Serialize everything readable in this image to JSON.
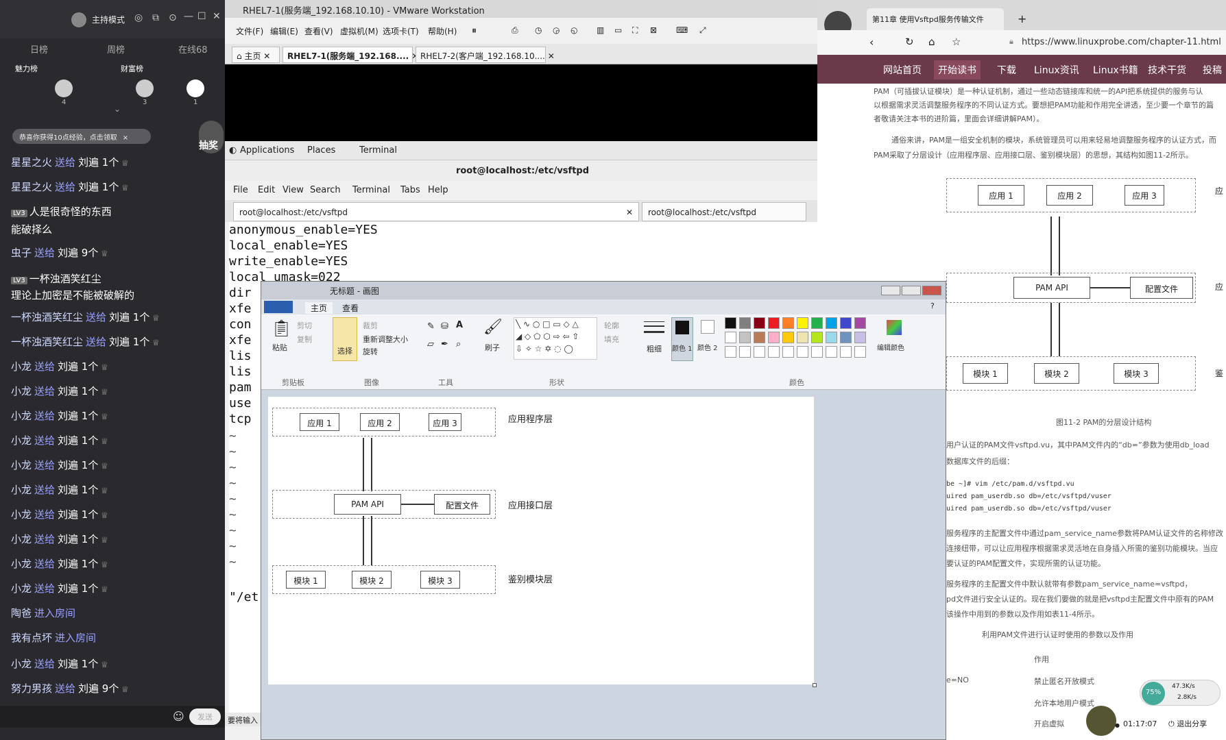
{
  "live": {
    "mode": "主持模式",
    "tabs": [
      "日榜",
      "周榜",
      "在线68"
    ],
    "rank_labels": [
      "魅力榜",
      "财富榜"
    ],
    "rank_counts": [
      "4",
      "3",
      "1"
    ],
    "banner": "恭喜你获得10点经验，点击领取",
    "badge": "抽奖",
    "messages": [
      {
        "lvl": "",
        "name": "星星之火",
        "act": "送给",
        "gift": "刘遍 1个"
      },
      {
        "lvl": "",
        "name": "星星之火",
        "act": "送给",
        "gift": "刘遍 1个"
      },
      {
        "lvl": "LV3",
        "name": "人是很奇怪的东西",
        "act": "",
        "gift": ""
      },
      {
        "lvl": "",
        "name": "能破择么",
        "act": "",
        "gift": ""
      },
      {
        "lvl": "",
        "name": "虫子",
        "act": "送给",
        "gift": "刘遍 9个"
      },
      {
        "lvl": "LV3",
        "name": "一杯浊酒笑红尘",
        "act": "",
        "gift": ""
      },
      {
        "lvl": "",
        "name": "理论上加密是不能被破解的",
        "act": "",
        "gift": ""
      },
      {
        "lvl": "",
        "name": "一杯浊酒笑红尘",
        "act": "送给",
        "gift": "刘遍 1个"
      },
      {
        "lvl": "",
        "name": "一杯浊酒笑红尘",
        "act": "送给",
        "gift": "刘遍 1个"
      },
      {
        "lvl": "",
        "name": "小龙",
        "act": "送给",
        "gift": "刘遍 1个"
      },
      {
        "lvl": "",
        "name": "小龙",
        "act": "送给",
        "gift": "刘遍 1个"
      },
      {
        "lvl": "",
        "name": "小龙",
        "act": "送给",
        "gift": "刘遍 1个"
      },
      {
        "lvl": "",
        "name": "小龙",
        "act": "送给",
        "gift": "刘遍 1个"
      },
      {
        "lvl": "",
        "name": "小龙",
        "act": "送给",
        "gift": "刘遍 1个"
      },
      {
        "lvl": "",
        "name": "小龙",
        "act": "送给",
        "gift": "刘遍 1个"
      },
      {
        "lvl": "",
        "name": "小龙",
        "act": "送给",
        "gift": "刘遍 1个"
      },
      {
        "lvl": "",
        "name": "小龙",
        "act": "送给",
        "gift": "刘遍 1个"
      },
      {
        "lvl": "",
        "name": "小龙",
        "act": "送给",
        "gift": "刘遍 1个"
      },
      {
        "lvl": "",
        "name": "小龙",
        "act": "送给",
        "gift": "刘遍 1个"
      },
      {
        "lvl": "",
        "name": "陶爸",
        "act": "进入房间",
        "gift": ""
      },
      {
        "lvl": "",
        "name": "我有点坏",
        "act": "进入房间",
        "gift": ""
      },
      {
        "lvl": "",
        "name": "小龙",
        "act": "送给",
        "gift": "刘遍 1个"
      },
      {
        "lvl": "",
        "name": "努力男孩",
        "act": "送给",
        "gift": "刘遍 9个"
      }
    ],
    "send_label": "发送"
  },
  "vmware": {
    "title": "RHEL7-1(服务端_192.168.10.10) - VMware Workstation",
    "menu": [
      "文件(F)",
      "编辑(E)",
      "查看(V)",
      "虚拟机(M)",
      "选项卡(T)",
      "帮助(H)"
    ],
    "tabs": [
      "主页",
      "RHEL7-1(服务端_192.168....",
      "RHEL7-2(客户端_192.168.10...."
    ],
    "gnome": [
      "Applications",
      "Places",
      "Terminal"
    ],
    "term_title": "root@localhost:/etc/vsftpd",
    "term_menu": [
      "File",
      "Edit",
      "View",
      "Search",
      "Terminal",
      "Tabs",
      "Help"
    ],
    "term_tabs": [
      "root@localhost:/etc/vsftpd",
      "root@localhost:/etc/vsftpd"
    ],
    "lines": [
      "anonymous_enable=YES",
      "local_enable=YES",
      "write_enable=YES",
      "local_umask=022",
      "dir",
      "xfe",
      "con",
      "xfe",
      "lis",
      "lis",
      "pam",
      "use",
      "tcp"
    ],
    "last_line": "\"/et",
    "status": "要将输入"
  },
  "browser": {
    "tab_title": "第11章 使用Vsftpd服务传输文件",
    "url": "https://www.linuxprobe.com/chapter-11.html",
    "nav": [
      "网站首页",
      "开始读书",
      "下载",
      "Linux资讯",
      "Linux书籍",
      "技术干货",
      "投稿"
    ],
    "para1": [
      "PAM（可插拔认证模块）是一种认证机制，通过一些动态链接库和统一的API把系统提供的服务与认",
      "以根据需求灵活调整服务程序的不同认证方式。要想把PAM功能和作用完全讲透，至少要一个章节的篇",
      "者敬请关注本书的进阶篇，里面会详细讲解PAM）。"
    ],
    "para2": [
      "通俗来讲，PAM是一组安全机制的模块，系统管理员可以用来轻易地调整服务程序的认证方式，而",
      "PAM采取了分层设计（应用程序层、应用接口层、鉴别模块层）的思想，其结构如图11-2所示。"
    ],
    "diagram": {
      "apps": [
        "应用 1",
        "应用 2",
        "应用 3"
      ],
      "api": "PAM API",
      "config": "配置文件",
      "modules": [
        "模块 1",
        "模块 2",
        "模块 3"
      ],
      "side": [
        "应",
        "应",
        "鉴"
      ]
    },
    "caption": "图11-2  PAM的分层设计结构",
    "para3": [
      "用户认证的PAM文件vsftpd.vu，其中PAM文件内的“db=”参数为使用db_load",
      "数据库文件的后缀："
    ],
    "code": [
      "be ~]# vim /etc/pam.d/vsftpd.vu",
      "uired      pam_userdb.so db=/etc/vsftpd/vuser",
      "uired      pam_userdb.so db=/etc/vsftpd/vuser"
    ],
    "para4": [
      "服务程序的主配置文件中通过pam_service_name参数将PAM认证文件的名称修改",
      "连接纽带，可以让应用程序根据需求灵活地在自身插入所需的鉴别功能模块。当应",
      "要认证的PAM配置文件，实现所需的认证功能。"
    ],
    "para5": [
      "服务程序的主配置文件中默认就带有参数pam_service_name=vsftpd，",
      "pd文件进行安全认证的。现在我们要做的就是把vsftpd主配置文件中原有的PAM",
      "该操作中用到的参数以及作用如表11-4所示。"
    ],
    "table_title": "利用PAM文件进行认证时使用的参数以及作用",
    "table_head": "作用",
    "table_rows": [
      [
        "e=NO",
        "禁止匿名开放模式"
      ],
      [
        "",
        "允许本地用户模式"
      ],
      [
        "",
        "开启虚拟"
      ]
    ],
    "gauge": "75%",
    "speed_up": "47.3K/s",
    "speed_down": "2.8K/s",
    "timer": "01:17:07",
    "exit_share": "退出分享"
  },
  "paint": {
    "title": "无标题 - 画图",
    "tabs": [
      "主页",
      "查看"
    ],
    "clip": [
      "粘贴",
      "剪切",
      "复制"
    ],
    "image": [
      "选择",
      "裁剪",
      "重新调整大小",
      "旋转"
    ],
    "brush": "刷子",
    "shape_opts": [
      "轮廓",
      "填充"
    ],
    "size": "粗细",
    "color1": "颜色 1",
    "color2": "颜色 2",
    "edit_colors": "编辑颜色",
    "groups": [
      "剪贴板",
      "图像",
      "工具",
      "形状",
      "颜色"
    ],
    "diagram": {
      "apps": [
        "应用 1",
        "应用 2",
        "应用 3"
      ],
      "api": "PAM   API",
      "config": "配置文件",
      "modules": [
        "模块 1",
        "模块 2",
        "模块 3"
      ],
      "layers": [
        "应用程序层",
        "应用接口层",
        "鉴别模块层"
      ]
    },
    "palette": [
      "#111111",
      "#7f7f7f",
      "#880015",
      "#ed1c24",
      "#ff7f27",
      "#fff200",
      "#22b14c",
      "#00a2e8",
      "#3f48cc",
      "#a349a4",
      "#ffffff",
      "#c3c3c3",
      "#b97a57",
      "#ffaec9",
      "#ffc90e",
      "#efe4b0",
      "#b5e61d",
      "#99d9ea",
      "#7092be",
      "#c8bfe7"
    ]
  }
}
